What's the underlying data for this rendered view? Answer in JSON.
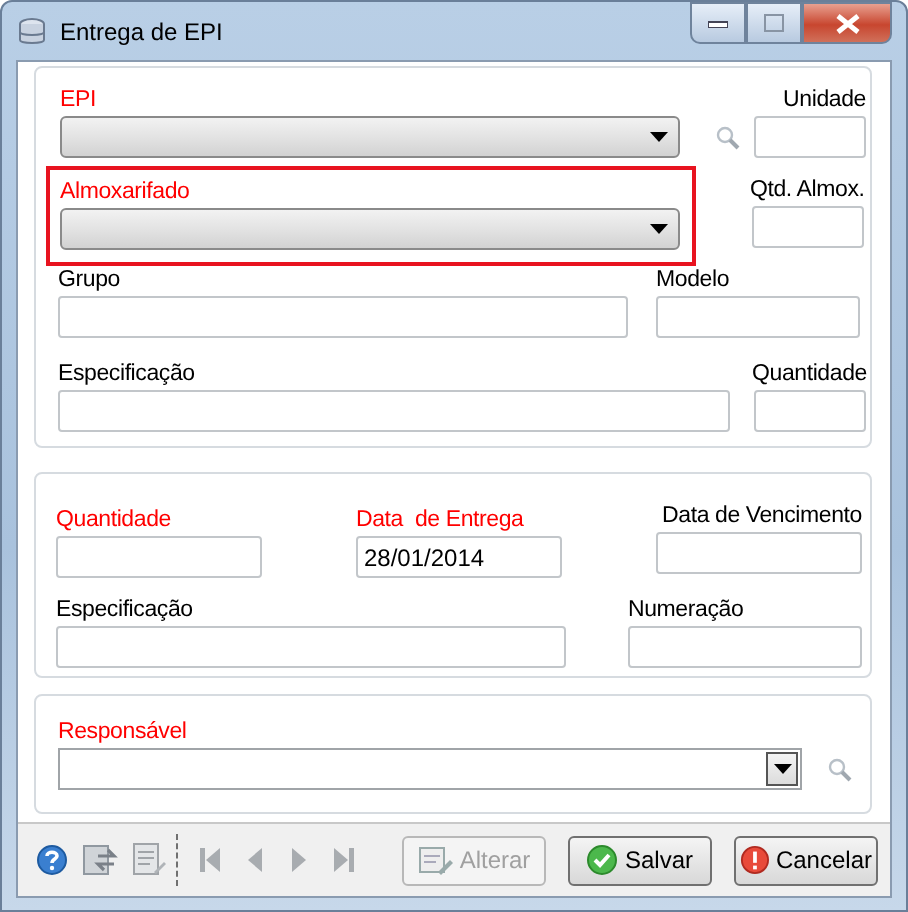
{
  "window": {
    "title": "Entrega de EPI"
  },
  "epi_panel": {
    "epi": {
      "label": "EPI",
      "required": true
    },
    "unidade": {
      "label": "Unidade",
      "required": false
    },
    "almoxarifado": {
      "label": "Almoxarifado",
      "required": true,
      "highlighted": true
    },
    "qtd_almox": {
      "label": "Qtd. Almox.",
      "required": false
    },
    "grupo": {
      "label": "Grupo",
      "required": false
    },
    "modelo": {
      "label": "Modelo",
      "required": false
    },
    "especificacao": {
      "label": "Especificação",
      "required": false
    },
    "quantidade": {
      "label": "Quantidade",
      "required": false
    }
  },
  "delivery_panel": {
    "quantidade": {
      "label": "Quantidade",
      "required": true
    },
    "data_entrega": {
      "label": "Data  de Entrega",
      "required": true,
      "value": "28/01/2014"
    },
    "data_vencimento": {
      "label": "Data de Vencimento",
      "required": false
    },
    "especificacao": {
      "label": "Especificação",
      "required": false
    },
    "numeracao": {
      "label": "Numeração",
      "required": false
    }
  },
  "responsavel_panel": {
    "responsavel": {
      "label": "Responsável",
      "required": true
    }
  },
  "buttons": [
    {
      "kind": "edit",
      "label": "Alterar",
      "disabled": true
    },
    {
      "kind": "save",
      "label": "Salvar",
      "disabled": false
    },
    {
      "kind": "cancel",
      "label": "Cancelar",
      "disabled": false
    }
  ]
}
